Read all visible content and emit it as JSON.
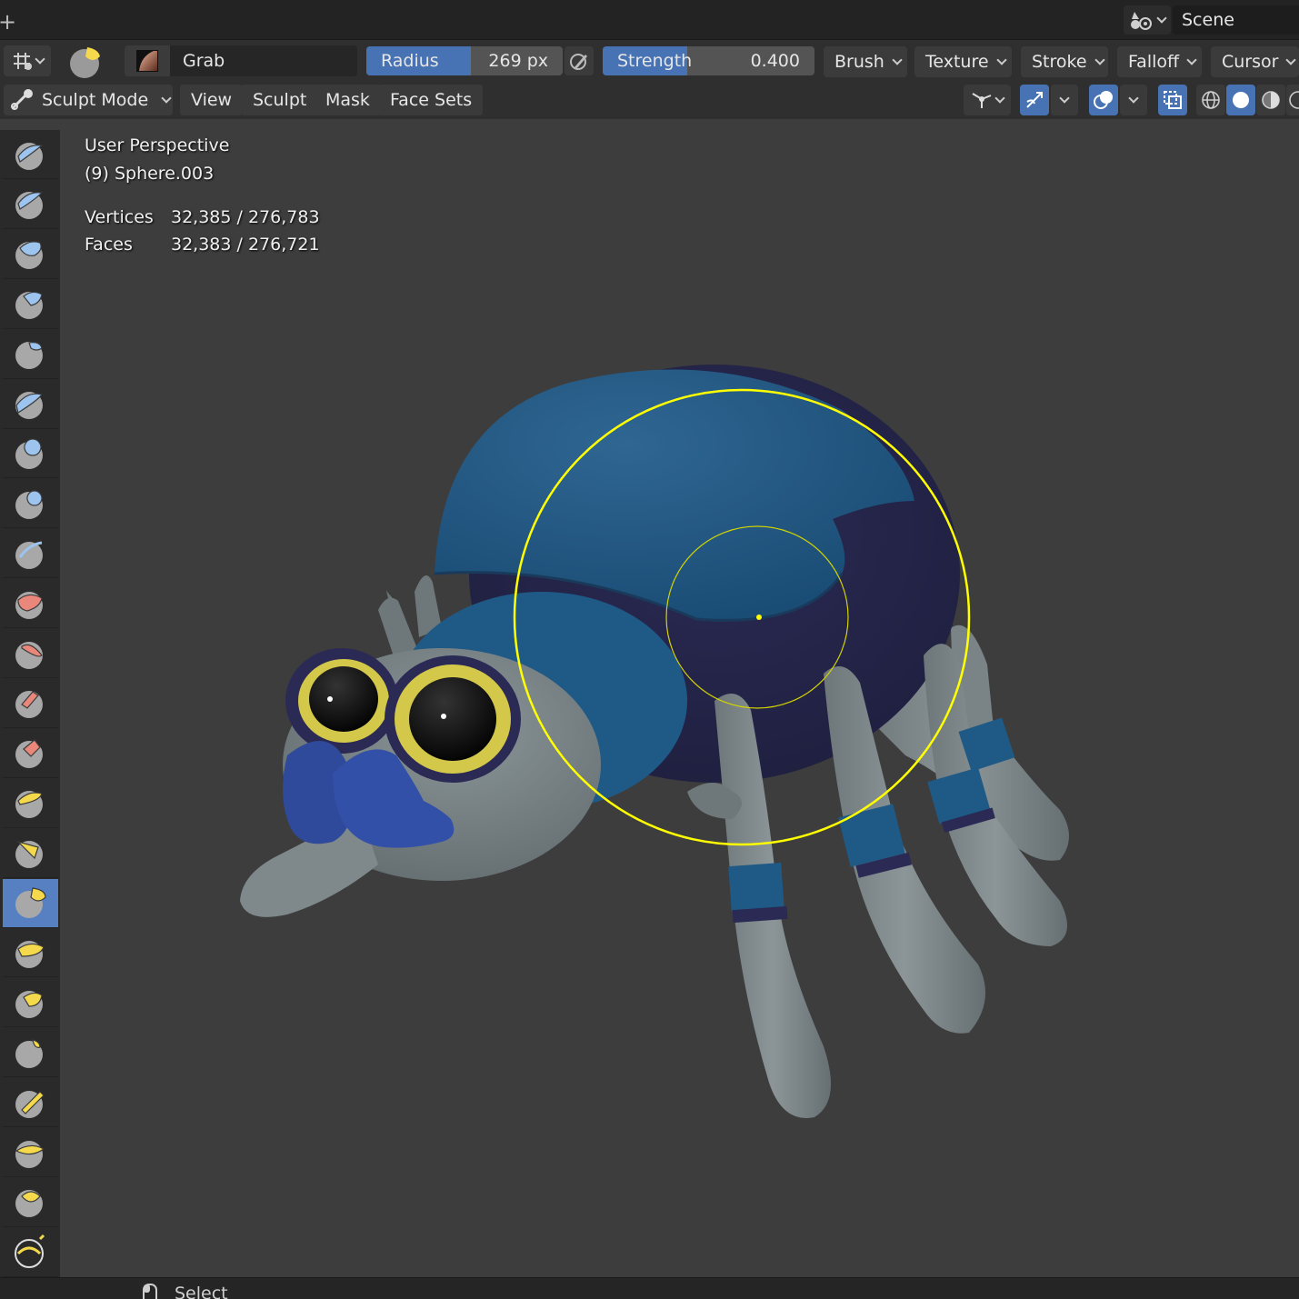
{
  "topbar": {
    "scene_label": "Scene"
  },
  "tool_header": {
    "brush_name": "Grab",
    "radius": {
      "label": "Radius",
      "value": "269 px"
    },
    "strength": {
      "label": "Strength",
      "value": "0.400",
      "fraction": 0.4
    },
    "menus": [
      "Brush",
      "Texture",
      "Stroke",
      "Falloff",
      "Cursor"
    ]
  },
  "mode_header": {
    "mode": "Sculpt Mode",
    "menus": [
      "View",
      "Sculpt",
      "Mask",
      "Face Sets"
    ]
  },
  "viewport": {
    "view_name": "User Perspective",
    "object_name": "(9) Sphere.003",
    "stats": [
      {
        "label": "Vertices",
        "value": "32,385 / 276,783"
      },
      {
        "label": "Faces",
        "value": "32,383 / 276,721"
      }
    ]
  },
  "toolbar": {
    "active_index": 15,
    "tools": [
      "draw-brush-icon",
      "draw-sharp-brush-icon",
      "clay-brush-icon",
      "clay-strips-brush-icon",
      "clay-thumb-brush-icon",
      "layer-brush-icon",
      "inflate-brush-icon",
      "blob-brush-icon",
      "crease-brush-icon",
      "smooth-brush-icon",
      "flatten-brush-icon",
      "fill-brush-icon",
      "scrape-brush-icon",
      "multiplane-scrape-brush-icon",
      "pinch-brush-icon",
      "grab-brush-icon",
      "elastic-deform-brush-icon",
      "snake-hook-brush-icon",
      "thumb-brush-icon",
      "pose-brush-icon",
      "nudge-brush-icon",
      "rotate-brush-icon",
      "slide-relax-brush-icon"
    ]
  },
  "statusbar": {
    "select_label": "Select"
  },
  "colors": {
    "accent": "#4772b3",
    "cursor_ring": "#ffff00"
  }
}
